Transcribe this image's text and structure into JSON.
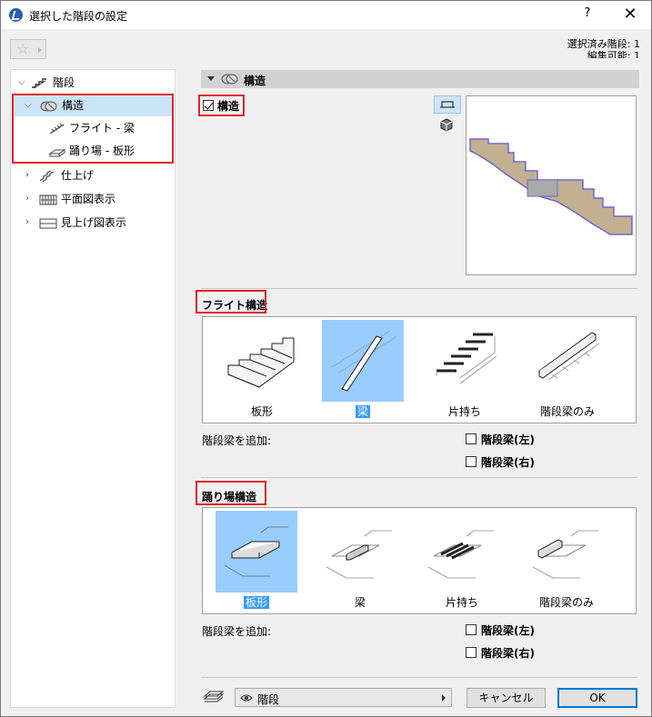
{
  "window": {
    "title": "選択した階段の設定",
    "help": "?",
    "close": "✕"
  },
  "header": {
    "favorites_icon": "star-icon",
    "selected_label": "選択済み階段: 1",
    "editable_label": "編集可能: 1"
  },
  "tree": {
    "items": [
      {
        "label": "階段",
        "icon": "stair-icon"
      },
      {
        "label": "構造",
        "icon": "structure-icon"
      },
      {
        "label": "フライト - 梁",
        "icon": "flight-beam-icon"
      },
      {
        "label": "踊り場 - 板形",
        "icon": "landing-slab-icon"
      },
      {
        "label": "仕上げ",
        "icon": "finish-icon"
      },
      {
        "label": "平面図表示",
        "icon": "floorplan-icon"
      },
      {
        "label": "見上げ図表示",
        "icon": "reflected-ceiling-icon"
      }
    ]
  },
  "section": {
    "title": "構造",
    "structure_checkbox": "構造"
  },
  "flight": {
    "title": "フライト構造",
    "options": [
      "板形",
      "梁",
      "片持ち",
      "階段梁のみ"
    ],
    "selected_index": 1,
    "add_label": "階段梁を追加:",
    "left_label": "階段梁(左)",
    "right_label": "階段梁(右)"
  },
  "landing": {
    "title": "踊り場構造",
    "options": [
      "板形",
      "梁",
      "片持ち",
      "階段梁のみ"
    ],
    "selected_index": 0,
    "add_label": "階段梁を追加:",
    "left_label": "階段梁(左)",
    "right_label": "階段梁(右)"
  },
  "footer": {
    "layer": "階段",
    "cancel": "キャンセル",
    "ok": "OK"
  },
  "colors": {
    "highlight": "#e3232b",
    "selection": "#99ccff",
    "accent": "#3399ff"
  }
}
